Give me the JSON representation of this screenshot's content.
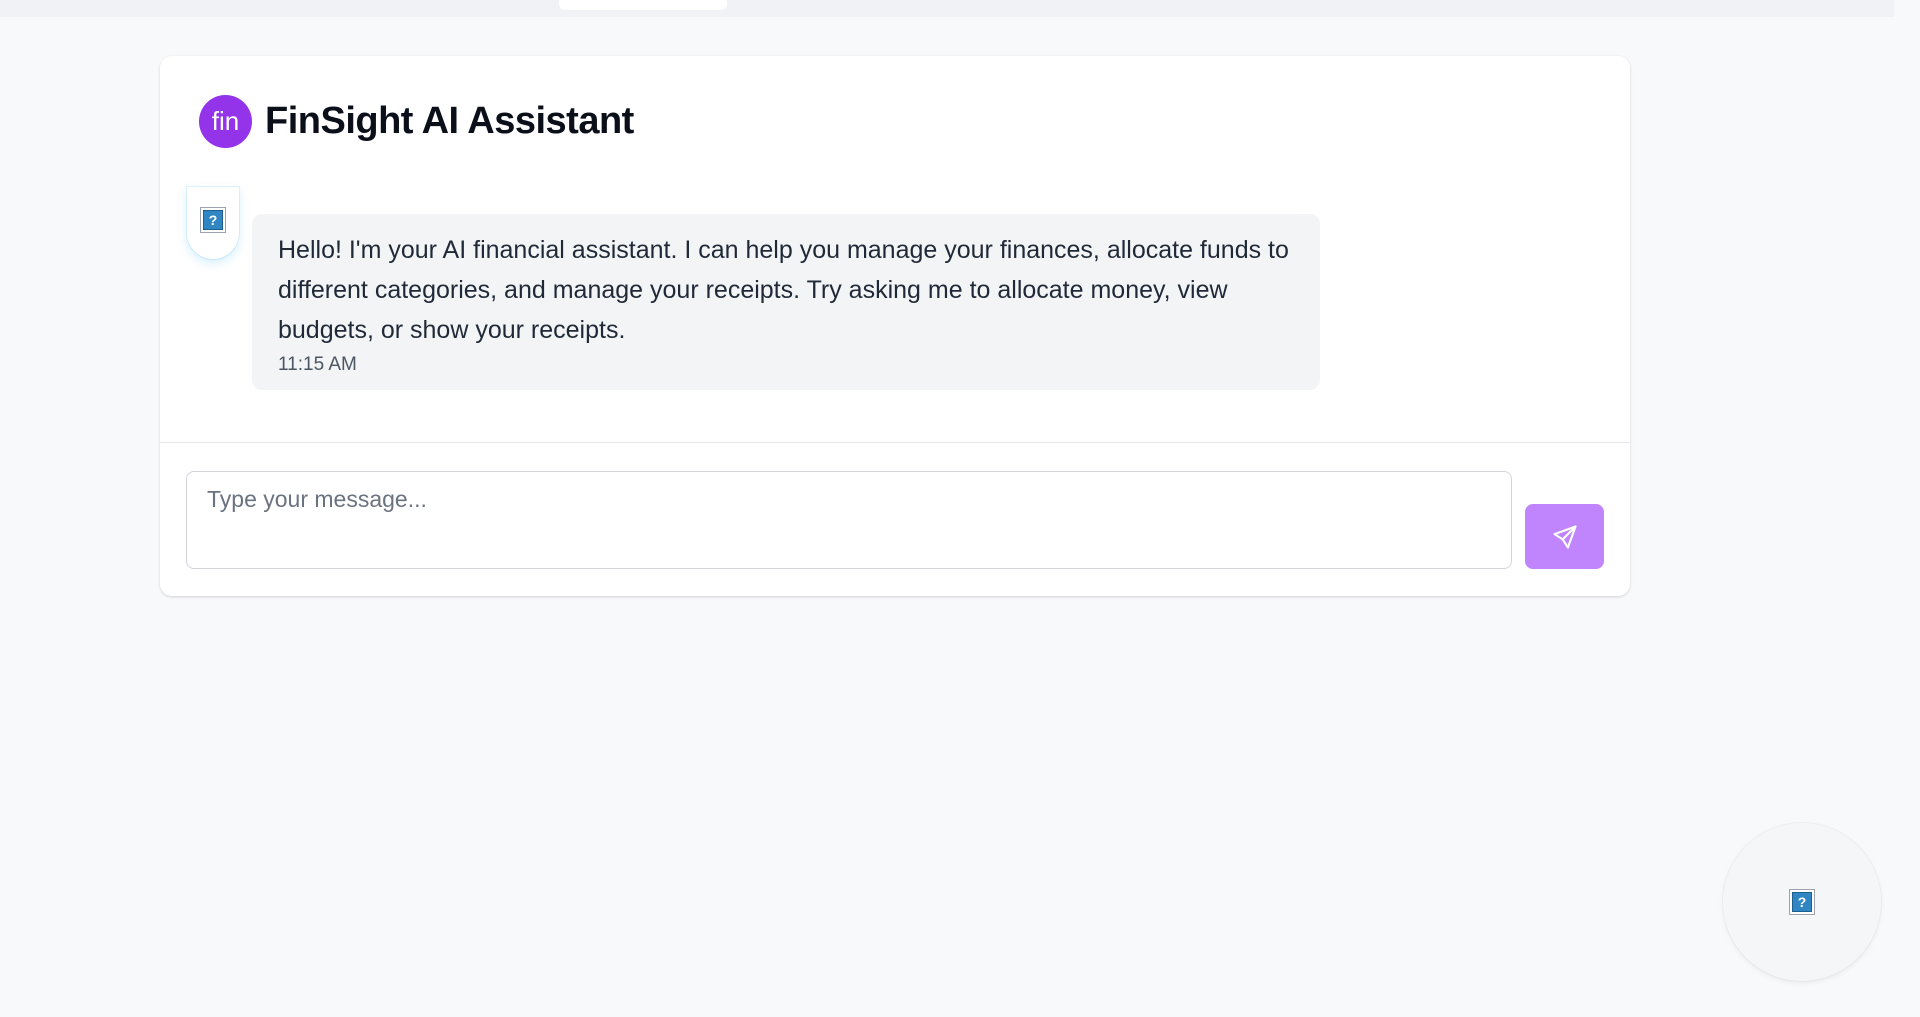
{
  "header": {
    "logo_text": "fin",
    "title": "FinSight AI Assistant"
  },
  "messages": [
    {
      "sender": "assistant",
      "avatar_icon": "broken-image-icon",
      "text": "Hello! I'm your AI financial assistant. I can help you manage your finances, allocate funds to different categories, and manage your receipts. Try asking me to allocate money, view budgets, or show your receipts.",
      "time": "11:15 AM"
    }
  ],
  "composer": {
    "placeholder": "Type your message...",
    "value": "",
    "send_icon": "send-icon"
  },
  "fab": {
    "icon": "broken-image-icon"
  },
  "colors": {
    "brand": "#9333ea",
    "send_button": "#c084fc",
    "bubble_bg": "#f3f4f6",
    "page_bg": "#f8f9fb"
  }
}
